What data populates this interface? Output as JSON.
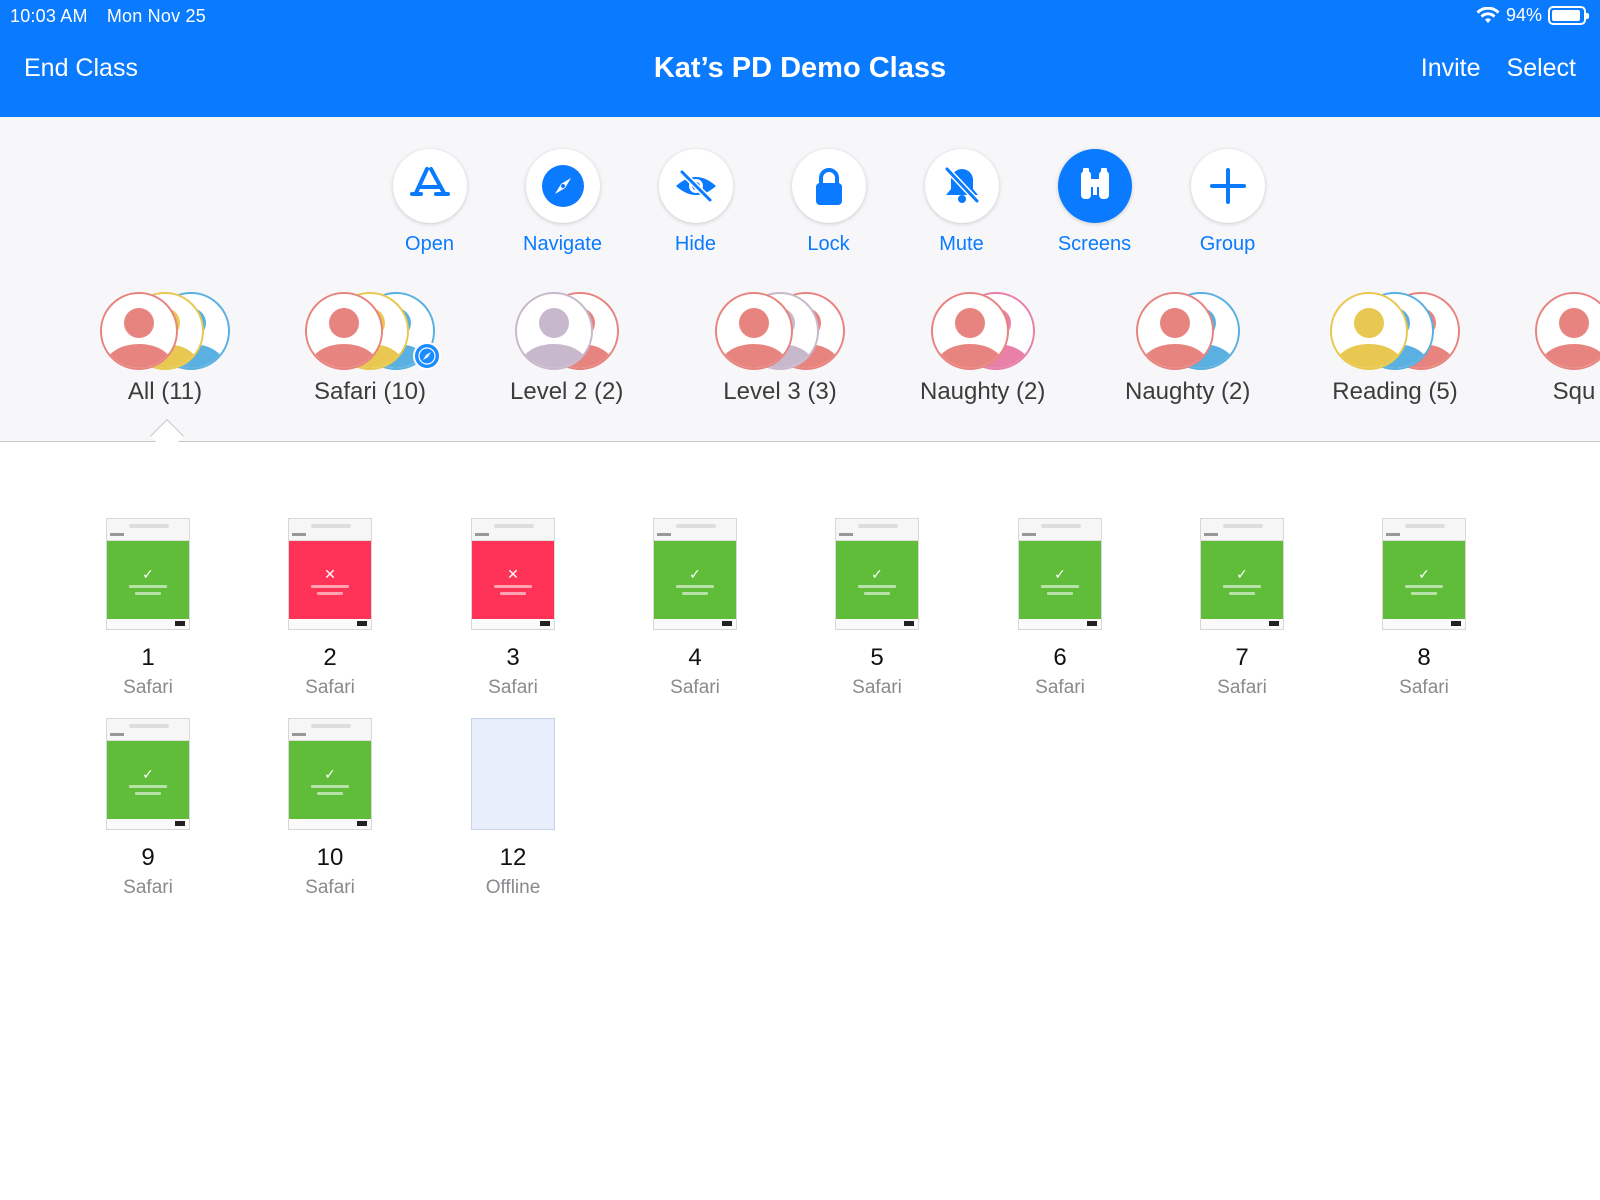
{
  "status": {
    "time": "10:03 AM",
    "date": "Mon Nov 25",
    "battery": "94%",
    "battery_level": 0.94
  },
  "nav": {
    "left": "End Class",
    "title": "Kat’s PD Demo Class",
    "invite": "Invite",
    "select": "Select"
  },
  "actions": [
    {
      "label": "Open",
      "icon": "app-store-icon",
      "active": false
    },
    {
      "label": "Navigate",
      "icon": "compass-icon",
      "active": false
    },
    {
      "label": "Hide",
      "icon": "eye-slash-icon",
      "active": false
    },
    {
      "label": "Lock",
      "icon": "lock-icon",
      "active": false
    },
    {
      "label": "Mute",
      "icon": "bell-slash-icon",
      "active": false
    },
    {
      "label": "Screens",
      "icon": "binoculars-icon",
      "active": true
    },
    {
      "label": "Group",
      "icon": "plus-icon",
      "active": false
    }
  ],
  "groups": [
    {
      "label": "All (11)",
      "selected": true,
      "avatars": [
        "#e8847f",
        "#e8c850",
        "#5ab0e0"
      ]
    },
    {
      "label": "Safari (10)",
      "selected": false,
      "avatars": [
        "#e8847f",
        "#e8c850",
        "#5ab0e0"
      ],
      "badge": "safari-icon"
    },
    {
      "label": "Level 2 (2)",
      "selected": false,
      "avatars": [
        "#c8b8cc",
        "#e8847f"
      ]
    },
    {
      "label": "Level 3 (3)",
      "selected": false,
      "avatars": [
        "#e8847f",
        "#c8b8cc",
        "#e8847f"
      ]
    },
    {
      "label": "Naughty (2)",
      "selected": false,
      "avatars": [
        "#e8847f",
        "#e880a8"
      ]
    },
    {
      "label": "Naughty (2)",
      "selected": false,
      "avatars": [
        "#e8847f",
        "#5ab0e0"
      ]
    },
    {
      "label": "Reading (5)",
      "selected": false,
      "avatars": [
        "#e8c850",
        "#5ab0e0",
        "#e8847f"
      ]
    },
    {
      "label": "Squ",
      "selected": false,
      "avatars": [
        "#e8847f"
      ]
    }
  ],
  "devices": [
    {
      "number": "1",
      "app": "Safari",
      "status": "green"
    },
    {
      "number": "2",
      "app": "Safari",
      "status": "red"
    },
    {
      "number": "3",
      "app": "Safari",
      "status": "red"
    },
    {
      "number": "4",
      "app": "Safari",
      "status": "green"
    },
    {
      "number": "5",
      "app": "Safari",
      "status": "green"
    },
    {
      "number": "6",
      "app": "Safari",
      "status": "green"
    },
    {
      "number": "7",
      "app": "Safari",
      "status": "green"
    },
    {
      "number": "8",
      "app": "Safari",
      "status": "green"
    },
    {
      "number": "9",
      "app": "Safari",
      "status": "green"
    },
    {
      "number": "10",
      "app": "Safari",
      "status": "green"
    },
    {
      "number": "12",
      "app": "Offline",
      "status": "offline"
    }
  ],
  "colors": {
    "accent": "#0a7aff",
    "green": "#5fbd3a",
    "red": "#ff3358"
  }
}
